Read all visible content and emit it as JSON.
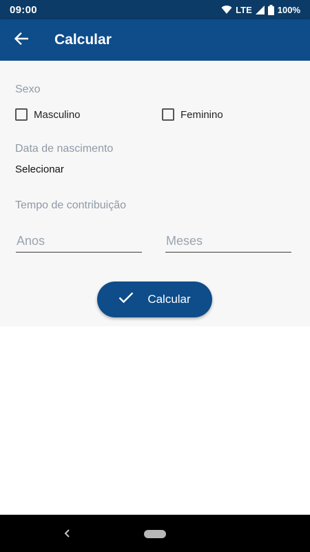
{
  "status_bar": {
    "time": "09:00",
    "network": "LTE",
    "battery": "100%",
    "icons": [
      "wifi-icon",
      "signal-icon",
      "battery-icon"
    ]
  },
  "app_bar": {
    "title": "Calcular",
    "back_icon": "arrow-left-icon"
  },
  "form": {
    "sex_label": "Sexo",
    "options": {
      "male": {
        "label": "Masculino",
        "checked": false
      },
      "female": {
        "label": "Feminino",
        "checked": false
      }
    },
    "birth_label": "Data de nascimento",
    "birth_select": "Selecionar",
    "contribution_label": "Tempo de contribuição",
    "years": {
      "placeholder": "Anos",
      "value": ""
    },
    "months": {
      "placeholder": "Meses",
      "value": ""
    },
    "submit_label": "Calcular",
    "submit_icon": "check-icon"
  },
  "nav_bar": {
    "icons": [
      "nav-back-icon",
      "nav-home-pill"
    ]
  },
  "colors": {
    "primary": "#0e4c8a",
    "status_bar": "#0b3b66",
    "muted_label": "#8e9aa6",
    "content_bg": "#f7f7f7"
  }
}
